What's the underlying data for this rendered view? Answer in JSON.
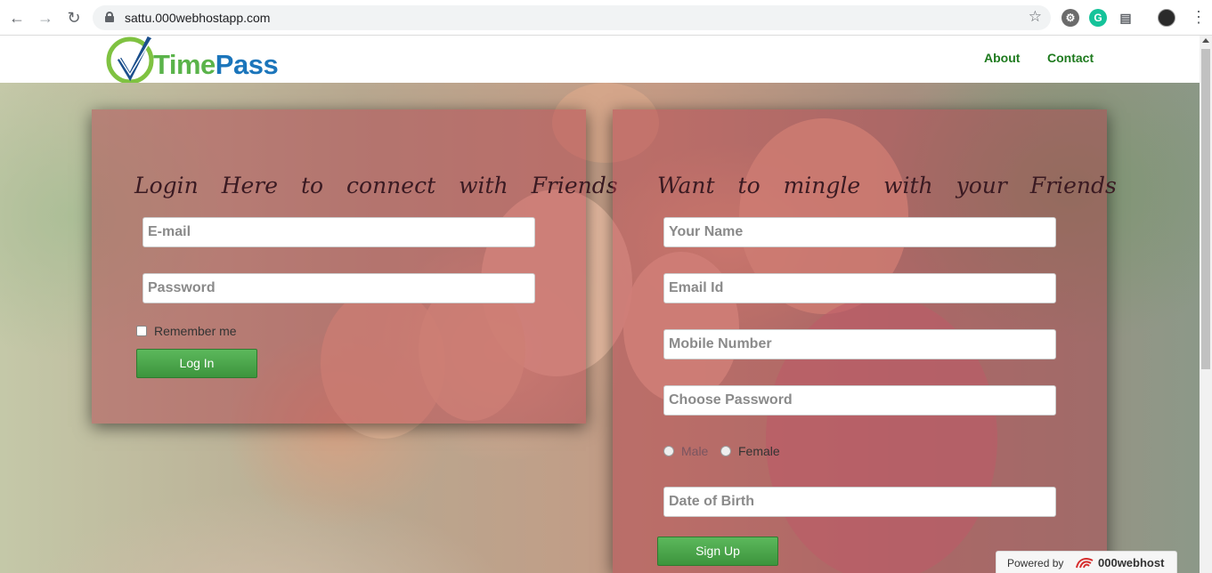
{
  "browser": {
    "url": "sattu.000webhostapp.com"
  },
  "header": {
    "logo_text_1": "Time",
    "logo_text_2": "Pass",
    "nav": [
      "About",
      "Contact"
    ]
  },
  "login": {
    "title": "Login Here to connect with Friends",
    "email_placeholder": "E-mail",
    "password_placeholder": "Password",
    "remember_label": "Remember me",
    "submit_label": "Log In"
  },
  "signup": {
    "title": "Want to mingle with your Friends",
    "name_placeholder": "Your Name",
    "email_placeholder": "Email Id",
    "mobile_placeholder": "Mobile Number",
    "password_placeholder": "Choose Password",
    "gender_options": [
      "Male",
      "Female"
    ],
    "dob_placeholder": "Date of Birth",
    "submit_label": "Sign Up"
  },
  "footer": {
    "powered_by": "Powered by",
    "brand": "000webhost"
  },
  "colors": {
    "nav_link": "#1e7a1e",
    "button": "#4cae4c",
    "panel_overlay": "#af3746",
    "logo_green": "#5ab34a",
    "logo_blue": "#1b75bb"
  }
}
